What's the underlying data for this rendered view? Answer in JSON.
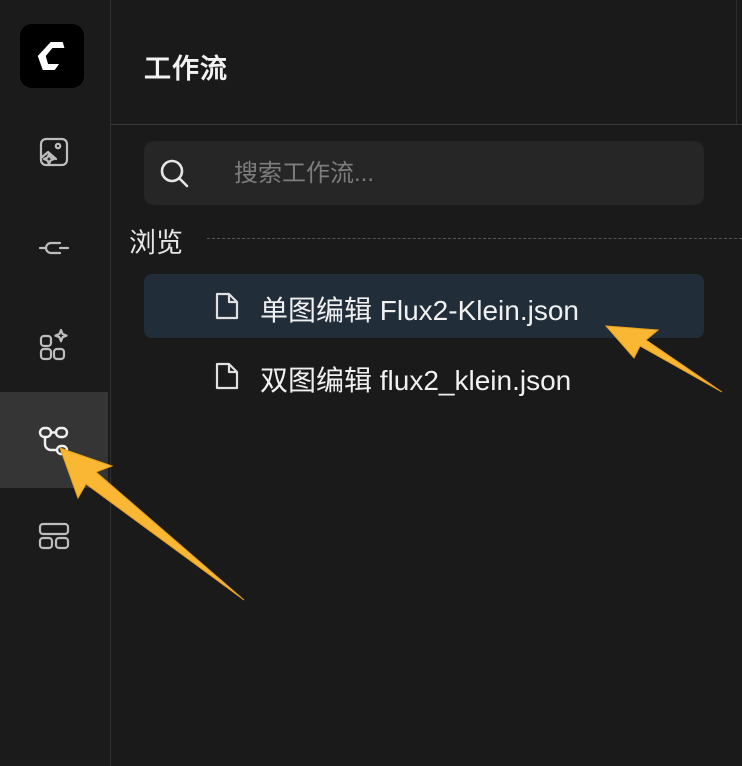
{
  "sidebar": {
    "items": [
      {
        "name": "image-sparkle-icon",
        "active": false
      },
      {
        "name": "connector-icon",
        "active": false
      },
      {
        "name": "apps-sparkle-icon",
        "active": false
      },
      {
        "name": "workflow-icon",
        "active": true
      },
      {
        "name": "layout-icon",
        "active": false
      }
    ]
  },
  "panel": {
    "title": "工作流",
    "search": {
      "placeholder": "搜索工作流..."
    },
    "section_label": "浏览",
    "files": [
      {
        "name": "单图编辑 Flux2-Klein.json",
        "selected": true
      },
      {
        "name": "双图编辑 flux2_klein.json",
        "selected": false
      }
    ]
  },
  "colors": {
    "background": "#1a1a1a",
    "active_rail": "#353535",
    "selected_item": "#222d3a",
    "annotation_arrow": "#f9b733"
  }
}
